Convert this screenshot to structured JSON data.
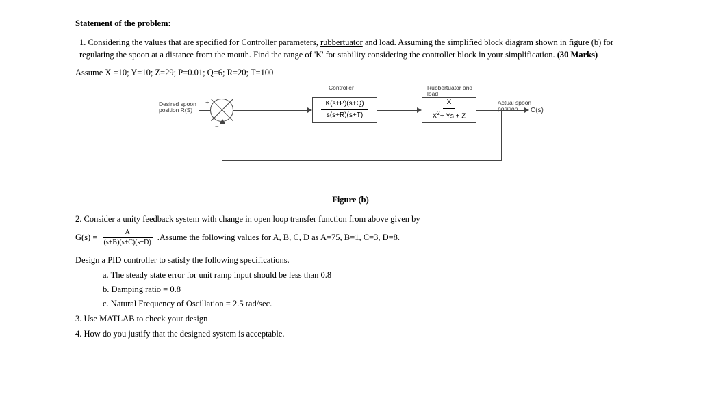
{
  "title": "Statement of the problem:",
  "p1_a": "1. Considering the values that are specified for Controller parameters, ",
  "p1_underlined": "rubbertuator",
  "p1_b": " and load. Assuming the simplified block diagram shown in figure (b) for regulating the spoon at a distance from the mouth. Find the range of 'K' for stability considering the controller block in your simplification.  ",
  "p1_marks": "(30 Marks)",
  "assume": "Assume X =10; Y=10; Z=29; P=0.01; Q=6; R=20; T=100",
  "diagram": {
    "controller": "Controller",
    "rubload": "Rubbertuator and load",
    "desired": "Desired spoon position R(S)",
    "actual": "Actual spoon position",
    "cs": "C(s)",
    "b1_top": "K(s+P)(s+Q)",
    "b1_bot": "s(s+R)(s+T)",
    "b2_top": "X",
    "b2_bot_pre": "X",
    "b2_bot_sup": "2",
    "b2_bot_post": "+ Ys + Z"
  },
  "fig_caption": "Figure (b)",
  "p2": "2. Consider a unity feedback system with change in open loop transfer function from above given by",
  "gs_lhs": "G(s) =",
  "gs_num": "A",
  "gs_den": "(s+B)(s+C)(s+D)",
  "gs_tail": " .Assume the following values for A, B, C, D as A=75, B=1, C=3, D=8.",
  "design_line": "Design a PID controller to satisfy the following specifications.",
  "spec_a": "a. The steady state error for unit ramp input should be less than 0.8",
  "spec_b": "b. Damping ratio = 0.8",
  "spec_c": "c. Natural Frequency of Oscillation = 2.5 rad/sec.",
  "p3": "3. Use MATLAB to check your design",
  "p4": "4. How do you justify that the designed system is acceptable."
}
